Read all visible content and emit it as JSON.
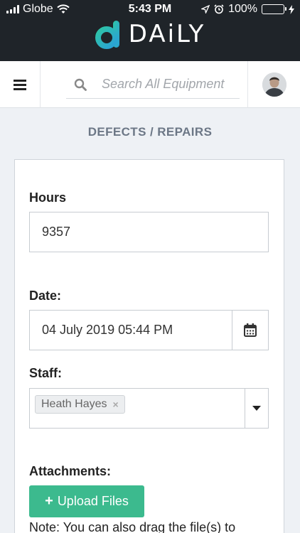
{
  "status_bar": {
    "carrier": "Globe",
    "time": "5:43 PM",
    "battery": "100%",
    "battery_level": 1.0
  },
  "brand": {
    "name": "DAiLY",
    "colors": {
      "mark_start": "#2ec4a6",
      "mark_end": "#2aa0d8"
    }
  },
  "navbar": {
    "search_placeholder": "Search All Equipment",
    "icons": [
      "menu-icon",
      "search-icon",
      "user-avatar"
    ]
  },
  "page": {
    "title": "DEFECTS / REPAIRS"
  },
  "form": {
    "hours": {
      "label": "Hours",
      "value": "9357"
    },
    "date": {
      "label": "Date:",
      "value": "04 July 2019 05:44 PM",
      "icon": "calendar-icon"
    },
    "staff": {
      "label": "Staff:",
      "selected": [
        "Heath Hayes"
      ],
      "remove_glyph": "×"
    },
    "attachments": {
      "label": "Attachments:",
      "upload_label": "Upload Files",
      "note": "Note: You can also drag the file(s) to"
    }
  },
  "colors": {
    "header_bg": "#1f2429",
    "page_bg": "#eef1f5",
    "accent_green": "#3cba8e",
    "title_gray": "#6c7786"
  }
}
